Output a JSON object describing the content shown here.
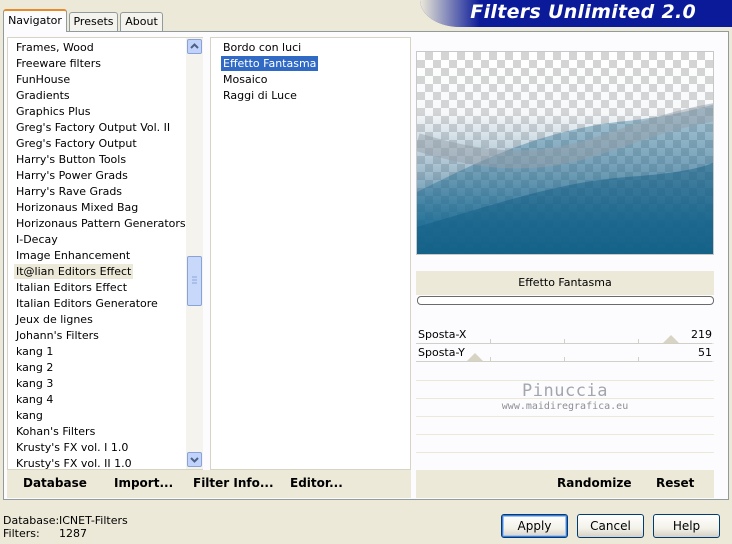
{
  "tabs": [
    {
      "label": "Navigator",
      "active": true
    },
    {
      "label": "Presets",
      "active": false
    },
    {
      "label": "About",
      "active": false
    }
  ],
  "banner_title": "Filters Unlimited 2.0",
  "categories": [
    "Frames, Wood",
    "Freeware filters",
    "FunHouse",
    "Gradients",
    "Graphics Plus",
    "Greg's Factory Output Vol. II",
    "Greg's Factory Output",
    "Harry's Button Tools",
    "Harry's Power Grads",
    "Harry's Rave Grads",
    "Horizonaus Mixed Bag",
    "Horizonaus Pattern Generators",
    "I-Decay",
    "Image Enhancement",
    "It@lian Editors Effect",
    "Italian Editors Effect",
    "Italian Editors Generatore",
    "Jeux de lignes",
    "Johann's Filters",
    "kang 1",
    "kang 2",
    "kang 3",
    "kang 4",
    "kang",
    "Kohan's Filters",
    "Krusty's FX vol. I 1.0",
    "Krusty's FX vol. II 1.0"
  ],
  "selected_category": "It@lian Editors Effect",
  "filters": [
    "Bordo con luci",
    "Effetto Fantasma",
    "Mosaico",
    "Raggi di Luce"
  ],
  "selected_filter": "Effetto Fantasma",
  "filter_name": "Effetto Fantasma",
  "params": [
    {
      "label": "Sposta-X",
      "value": "219",
      "fraction": 0.86
    },
    {
      "label": "Sposta-Y",
      "value": "51",
      "fraction": 0.2
    }
  ],
  "watermark": {
    "name": "Pinuccia",
    "url": "www.maidiregrafica.eu"
  },
  "toolbar": {
    "database": "Database",
    "import": "Import...",
    "filter_info": "Filter Info...",
    "editor": "Editor...",
    "randomize": "Randomize",
    "reset": "Reset"
  },
  "status": {
    "database_label": "Database:",
    "database_value": "ICNET-Filters",
    "filters_label": "Filters:",
    "filters_value": "1287"
  },
  "buttons": {
    "apply": "Apply",
    "cancel": "Cancel",
    "help": "Help"
  },
  "colors": {
    "banner": "#0a1a99",
    "selection": "#316ac5",
    "tab_accent": "#e68b2c"
  }
}
